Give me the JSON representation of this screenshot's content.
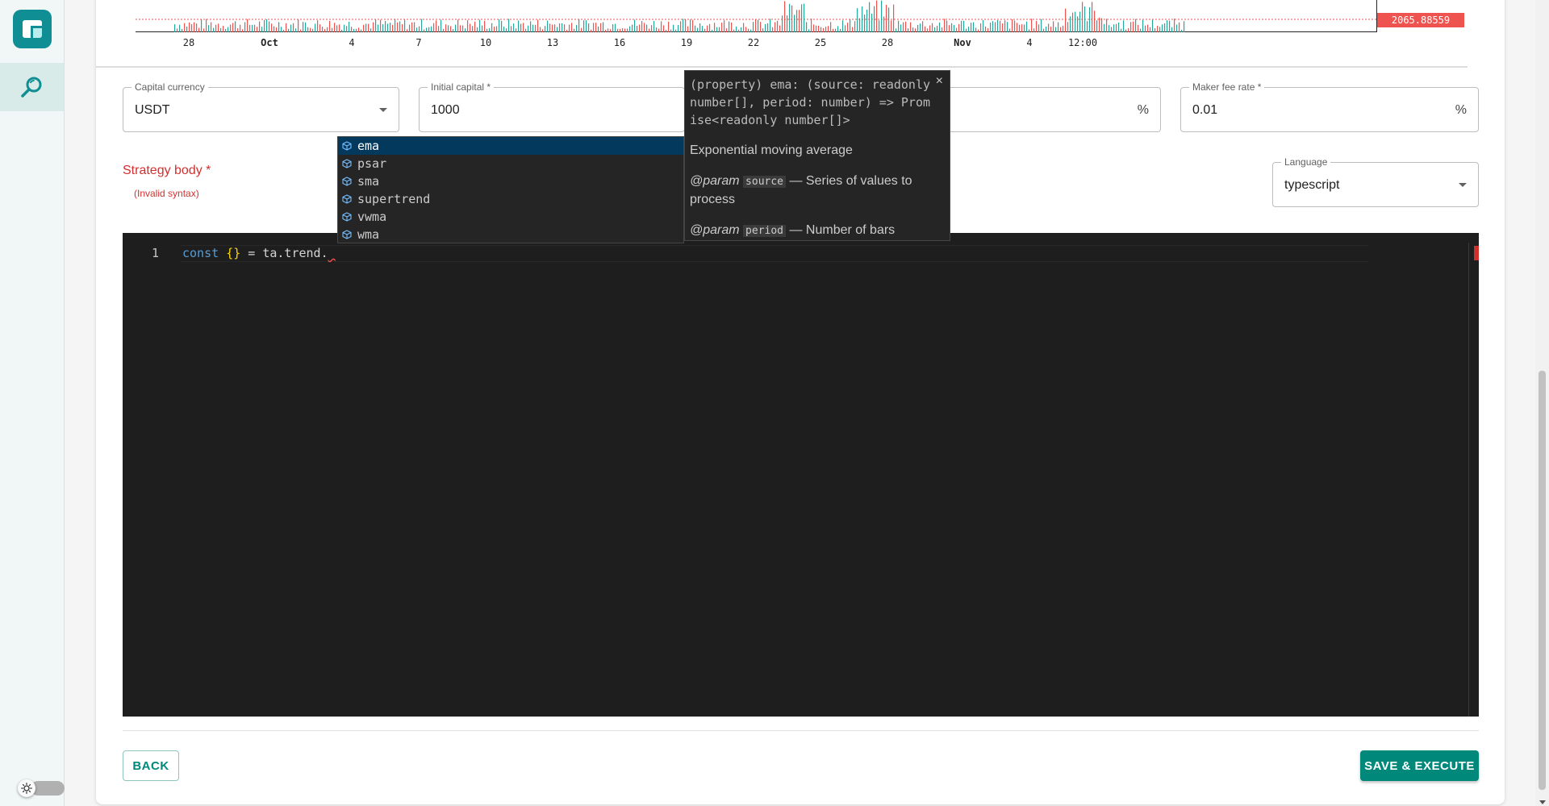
{
  "chart": {
    "price_label": "2065.88559",
    "ticks": [
      {
        "label": "28",
        "bold": false
      },
      {
        "label": "Oct",
        "bold": true
      },
      {
        "label": "4",
        "bold": false
      },
      {
        "label": "7",
        "bold": false
      },
      {
        "label": "10",
        "bold": false
      },
      {
        "label": "13",
        "bold": false
      },
      {
        "label": "16",
        "bold": false
      },
      {
        "label": "19",
        "bold": false
      },
      {
        "label": "22",
        "bold": false
      },
      {
        "label": "25",
        "bold": false
      },
      {
        "label": "28",
        "bold": false
      },
      {
        "label": "Nov",
        "bold": true
      },
      {
        "label": "4",
        "bold": false
      },
      {
        "label": "12:00",
        "bold": false
      }
    ],
    "colors": {
      "up": "#26a69a",
      "down": "#ef5350"
    }
  },
  "form": {
    "capital_currency": {
      "label": "Capital currency",
      "value": "USDT"
    },
    "initial_capital": {
      "label": "Initial capital *",
      "value": "1000"
    },
    "taker_fee": {
      "suffix": "%"
    },
    "maker_fee": {
      "label": "Maker fee rate *",
      "value": "0.01",
      "suffix": "%"
    },
    "strategy_body_label": "Strategy body *",
    "strategy_error": "(Invalid syntax)",
    "language": {
      "label": "Language",
      "value": "typescript"
    }
  },
  "editor": {
    "line_number": "1",
    "code": {
      "kw": "const",
      "braces": "{}",
      "rest": " = ta.trend.",
      "cursor": " "
    }
  },
  "suggest": {
    "items": [
      "ema",
      "psar",
      "sma",
      "supertrend",
      "vwma",
      "wma"
    ],
    "selected_index": 0,
    "item_icon": "symbol-property-icon"
  },
  "details": {
    "signature": "(property) ema: (source: readonly number[], period: number) => Promise<readonly number[]>",
    "description": "Exponential moving average",
    "params": [
      {
        "tag": "@param",
        "name": "source",
        "desc": "— Series of values to process"
      },
      {
        "tag": "@param",
        "name": "period",
        "desc": "— Number of bars"
      }
    ],
    "close": "×"
  },
  "buttons": {
    "back": "BACK",
    "save": "SAVE & EXECUTE"
  },
  "theme": {
    "accent": "#00897b",
    "error": "#d32f2f",
    "editor_bg": "#1e1e1e"
  }
}
